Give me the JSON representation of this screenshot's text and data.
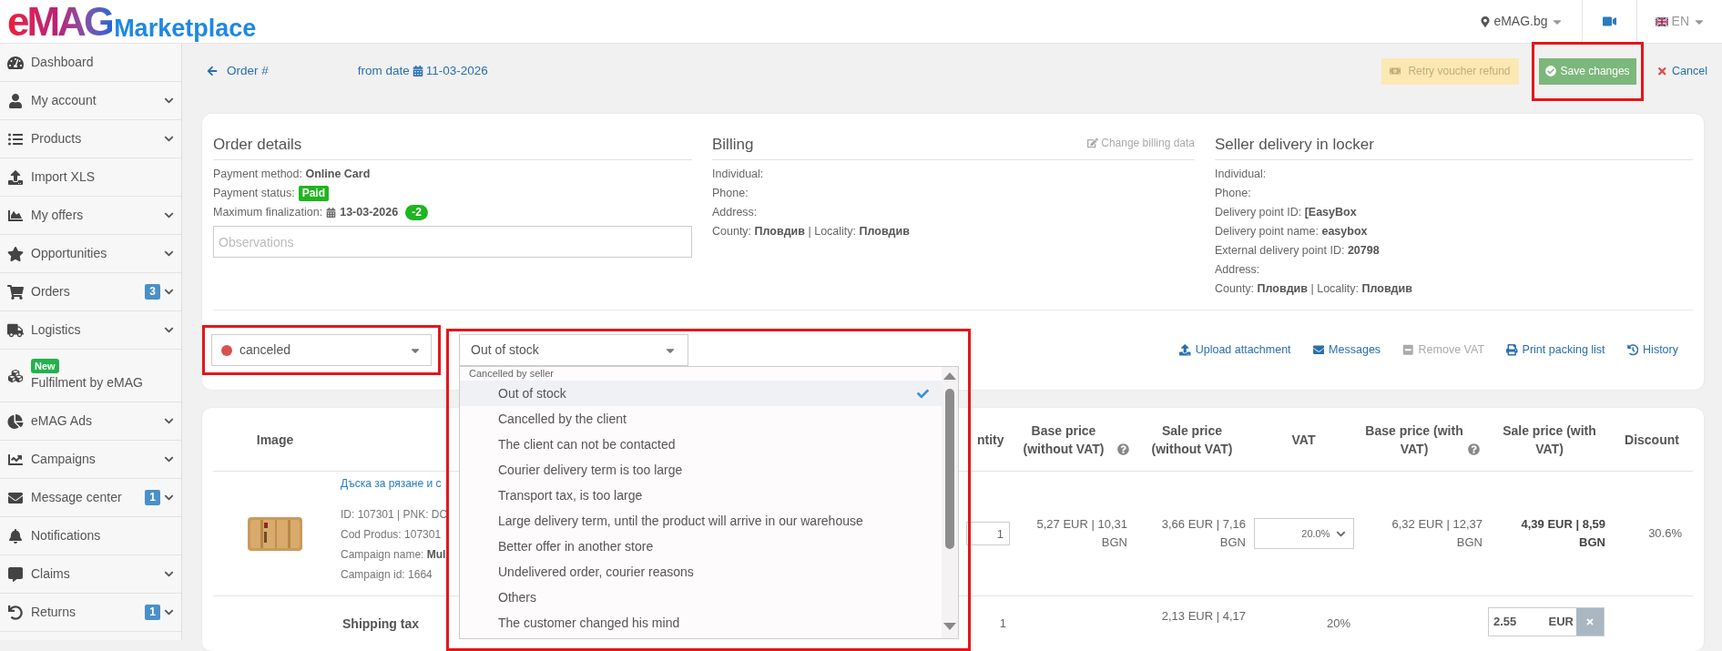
{
  "header": {
    "logo_brand": "eMAG",
    "logo_product": "Marketplace",
    "store": "eMAG.bg",
    "language": "EN"
  },
  "sidebar": {
    "items": [
      {
        "label": "Dashboard",
        "expandable": false
      },
      {
        "label": "My account",
        "expandable": true
      },
      {
        "label": "Products",
        "expandable": true
      },
      {
        "label": "Import XLS",
        "expandable": false
      },
      {
        "label": "My offers",
        "expandable": true
      },
      {
        "label": "Opportunities",
        "expandable": true
      },
      {
        "label": "Orders",
        "expandable": true,
        "badge": "3"
      },
      {
        "label": "Logistics",
        "expandable": true
      },
      {
        "label": "Fulfilment by eMAG",
        "expandable": false,
        "tag": "New"
      },
      {
        "label": "eMAG Ads",
        "expandable": true
      },
      {
        "label": "Campaigns",
        "expandable": true
      },
      {
        "label": "Message center",
        "expandable": true,
        "badge": "1"
      },
      {
        "label": "Notifications",
        "expandable": false
      },
      {
        "label": "Claims",
        "expandable": true
      },
      {
        "label": "Returns",
        "expandable": true,
        "badge": "1"
      }
    ]
  },
  "breadcrumb": {
    "back": "Order #",
    "date_label": "from date",
    "date": "11-03-2026"
  },
  "actions": [
    {
      "label": "Retry voucher refund",
      "kind": "warning",
      "disabled": true
    },
    {
      "label": "Save changes",
      "kind": "success",
      "highlighted": true
    },
    {
      "label": "Cancel",
      "kind": "link"
    }
  ],
  "order_details": {
    "title": "Order details",
    "fields": [
      {
        "label": "Payment method:",
        "value": "Online Card"
      },
      {
        "label": "Payment status:",
        "badge": "Paid",
        "kind": "status"
      },
      {
        "label": "Maximum finalization:",
        "value": "13-03-2026",
        "kind": "date",
        "badge": "-2"
      }
    ],
    "observations": {
      "placeholder": "Observations"
    }
  },
  "billing": {
    "title": "Billing",
    "action": "Change billing data",
    "fields": [
      {
        "label": "Individual:"
      },
      {
        "label": "Phone:"
      },
      {
        "label": "Address:"
      },
      {
        "label": "County:",
        "value": "Пловдив",
        "separator": "|",
        "label_2": "Locality:",
        "value_2": "Пловдив"
      }
    ]
  },
  "delivery": {
    "title": "Seller delivery in locker",
    "fields": [
      {
        "label": "Individual:"
      },
      {
        "label": "Phone:"
      },
      {
        "label": "Delivery point ID:",
        "value": "[EasyBox"
      },
      {
        "label": "Delivery point name:",
        "value": "easybox"
      },
      {
        "label": "External delivery point ID:",
        "value": "20798"
      },
      {
        "label": "Address:"
      },
      {
        "label": "County:",
        "value": "Пловдив",
        "separator": "|",
        "label_2": "Locality:",
        "value_2": "Пловдив"
      }
    ]
  },
  "order_status": {
    "value": "canceled",
    "color": "#d9534f",
    "highlighted": true
  },
  "reason": {
    "value": "Out of stock",
    "expanded": true,
    "highlighted": true,
    "group": "Cancelled by seller",
    "options": [
      {
        "label": "Out of stock",
        "selected": true
      },
      {
        "label": "Cancelled by the client",
        "selected": false
      },
      {
        "label": "The client can not be contacted",
        "selected": false
      },
      {
        "label": "Courier delivery term is too large",
        "selected": false
      },
      {
        "label": "Transport tax, is too large",
        "selected": false
      },
      {
        "label": "Large delivery term, until the product will arrive in our warehouse",
        "selected": false
      },
      {
        "label": "Better offer in another store",
        "selected": false
      },
      {
        "label": "Undelivered order, courier reasons",
        "selected": false
      },
      {
        "label": "Others",
        "selected": false
      },
      {
        "label": "The customer changed his mind",
        "selected": false
      }
    ]
  },
  "order_links": [
    {
      "label": "Upload attachment",
      "disabled": false
    },
    {
      "label": "Messages",
      "disabled": false
    },
    {
      "label": "Remove VAT",
      "disabled": true
    },
    {
      "label": "Print packing list",
      "disabled": false
    },
    {
      "label": "History",
      "disabled": false
    }
  ],
  "table": {
    "columns": [
      {
        "label": "Image"
      },
      {
        "label": "ntity"
      },
      {
        "label": "Base price (without VAT)",
        "help": true
      },
      {
        "label": "Sale price (without VAT)"
      },
      {
        "label": "VAT"
      },
      {
        "label": "Base price (with VAT)",
        "help": true
      },
      {
        "label": "Sale price (with VAT)"
      },
      {
        "label": "Discount"
      }
    ],
    "rows": [
      {
        "kind": "product",
        "image": {
          "kind": "picture"
        },
        "name": "Дъска за рязане и с",
        "details": [
          {
            "label": "ID: 107301 | PNK: DC"
          },
          {
            "label": "Cod Produs: 107301"
          },
          {
            "label": "Campaign name:",
            "value": "Mul"
          },
          {
            "label": "Campaign id: 1664"
          }
        ],
        "quantity": "1",
        "base_no_vat": "5,27 EUR | 10,31 BGN",
        "sale_no_vat": "3,66 EUR | 7,16 BGN",
        "vat": "20.0%",
        "base_vat": "6,32 EUR | 12,37 BGN",
        "sale_vat": "4,39 EUR | 8,59 BGN",
        "discount": "30.6%"
      },
      {
        "kind": "shipping",
        "name": "Shipping tax",
        "quantity": "1",
        "sale_no_vat": "2,13 EUR | 4,17",
        "vat": "20%",
        "sale_vat": "2.55",
        "unit": "EUR"
      }
    ]
  }
}
